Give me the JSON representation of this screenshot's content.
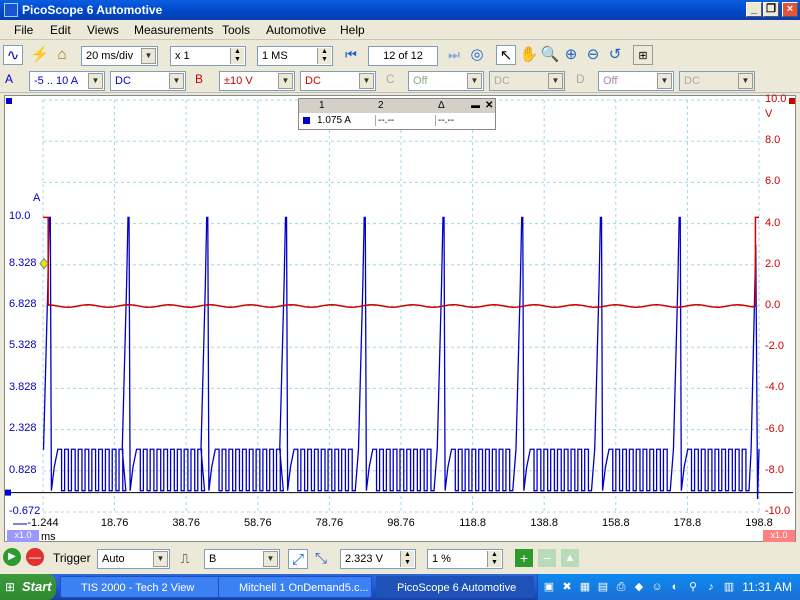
{
  "window": {
    "title": "PicoScope 6 Automotive"
  },
  "menu": [
    "File",
    "Edit",
    "Views",
    "Measurements",
    "Tools",
    "Automotive",
    "Help"
  ],
  "toolbar": {
    "timebase": "20 ms/div",
    "zoom": "x 1",
    "samples": "1 MS",
    "buffer_label": "12 of 12"
  },
  "channels": {
    "a": {
      "label": "A",
      "range": "-5 .. 10 A",
      "coupling": "DC",
      "color": "#0000c8"
    },
    "b": {
      "label": "B",
      "range": "±10 V",
      "coupling": "DC",
      "color": "#d00000"
    },
    "c": {
      "label": "C",
      "range": "Off",
      "coupling": "DC"
    },
    "d": {
      "label": "D",
      "range": "Off",
      "coupling": "DC"
    }
  },
  "ruler": {
    "col1": "1",
    "col2": "2",
    "col3": "Δ",
    "val1": "1.075 A",
    "val2": "--.--",
    "val3": "--.--"
  },
  "chart_data": {
    "type": "line",
    "xlabel": "ms",
    "xlim": [
      -1.244,
      198.8
    ],
    "x_ticks": [
      "-1.244",
      "18.76",
      "38.76",
      "58.76",
      "78.76",
      "98.76",
      "118.8",
      "138.8",
      "158.8",
      "178.8",
      "198.8"
    ],
    "left_axis": {
      "unit": "A",
      "ticks": [
        "10.0",
        "8.328",
        "6.828",
        "5.328",
        "3.828",
        "2.328",
        "0.828",
        "-0.672"
      ],
      "ylim": [
        -0.672,
        10.0
      ]
    },
    "right_axis": {
      "unit": "V",
      "ticks": [
        "10.0",
        "8.0",
        "6.0",
        "4.0",
        "2.0",
        "0.0",
        "-2.0",
        "-4.0",
        "-6.0",
        "-8.0",
        "-10.0"
      ],
      "ylim": [
        -10,
        10
      ]
    },
    "scale_left": "x1.0",
    "scale_right": "x1.0",
    "grid": true,
    "series": [
      {
        "name": "A",
        "color": "#0000c8",
        "pulse_times_ms": [
          0.5,
          22.5,
          44.5,
          66.5,
          88.5,
          110.5,
          132.5,
          154.5,
          176.5
        ],
        "peak_a": 10.0,
        "low_a": 0.1,
        "high_a": 1.6
      },
      {
        "name": "B",
        "color": "#d00000",
        "baseline_v": 0.0,
        "high_v": 4.3,
        "high_intervals_ms": [
          [
            -0.8,
            0.2
          ],
          [
            197.8,
            198.8
          ]
        ]
      }
    ]
  },
  "bottom_toolbar": {
    "trigger_label": "Trigger",
    "trigger_mode": "Auto",
    "trigger_channel": "B",
    "trigger_level": "2.323 V",
    "pretrigger": "1 %"
  },
  "taskbar": {
    "start": "Start",
    "tasks": [
      "TIS 2000 - Tech 2 View",
      "Mitchell 1 OnDemand5.c...",
      "PicoScope 6 Automotive"
    ],
    "clock": "11:31 AM"
  }
}
